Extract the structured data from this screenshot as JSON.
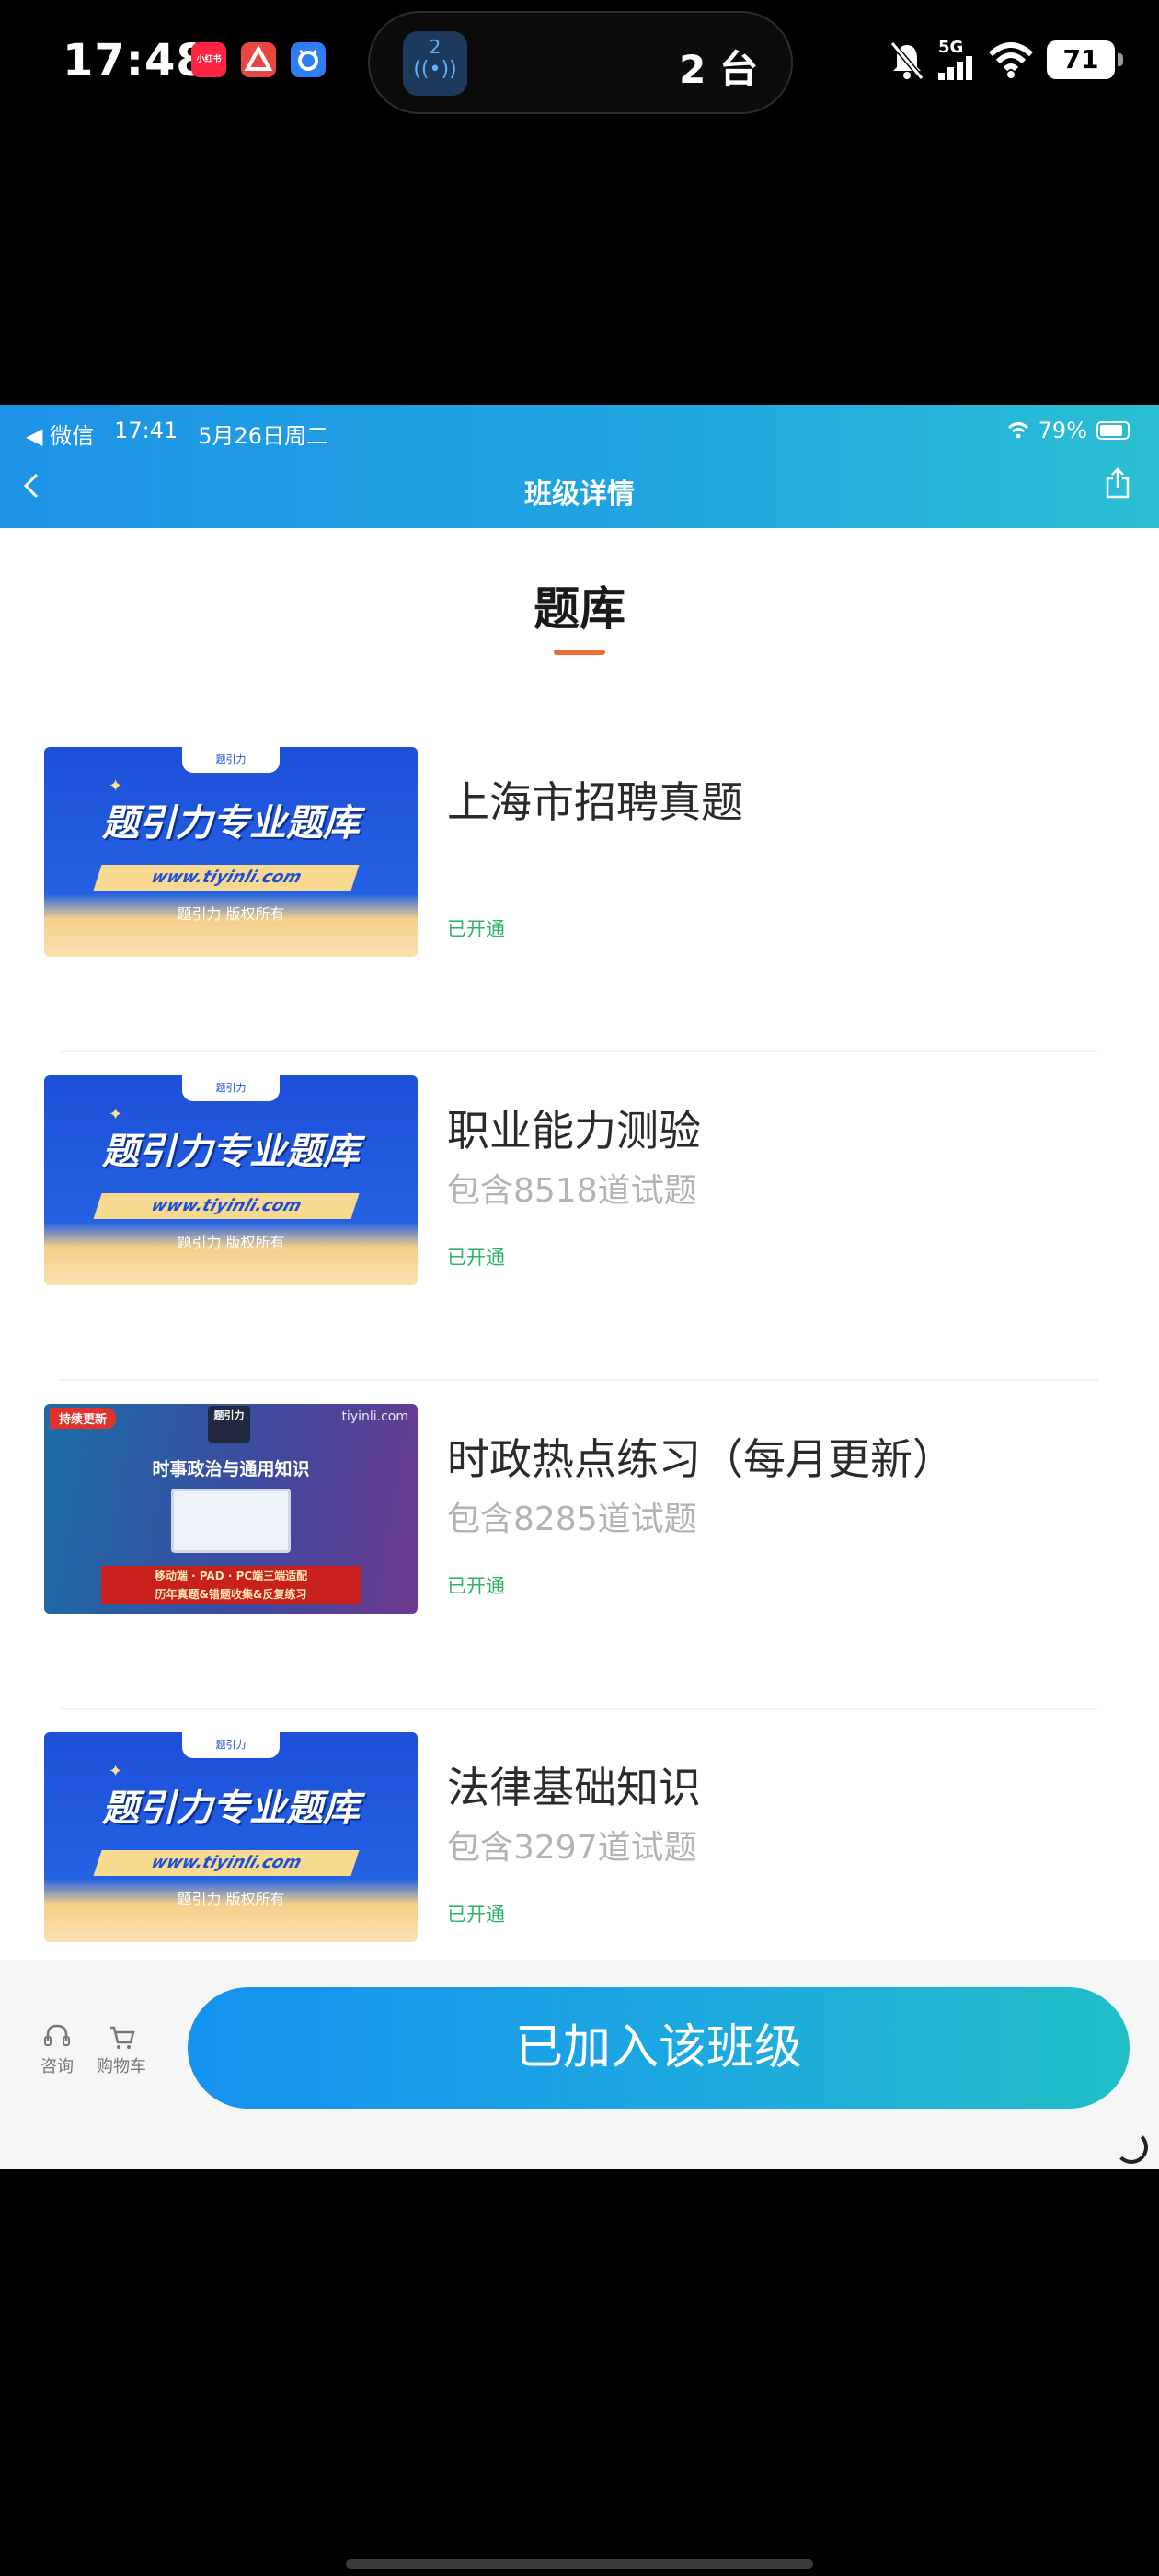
{
  "phone_status": {
    "time": "17:48",
    "app_icons": [
      {
        "name": "xiaohongshu-icon",
        "label": "小红书",
        "color": "#ff2442"
      },
      {
        "name": "alert-app-icon",
        "label": "",
        "color": "#e8463f"
      },
      {
        "name": "alarm-app-icon",
        "label": "",
        "color": "#2d7ef5"
      }
    ],
    "island": {
      "badge": "2",
      "text": "2 台"
    },
    "network": "5G",
    "battery": "71"
  },
  "app": {
    "inner_status": {
      "carrier": "◀ 微信",
      "time": "17:41",
      "date": "5月26日周二",
      "battery": "79%"
    },
    "header": {
      "back": "‹",
      "title": "班级详情"
    },
    "section": {
      "title": "题库",
      "accent": "#f26b3a"
    },
    "banks": [
      {
        "title": "上海市招聘真题",
        "count": "",
        "status": "已开通",
        "thumb": "blue"
      },
      {
        "title": "职业能力测验",
        "count": "包含8518道试题",
        "status": "已开通",
        "thumb": "blue"
      },
      {
        "title": "时政热点练习（每月更新）",
        "count": "包含8285道试题",
        "status": "已开通",
        "thumb": "purple"
      },
      {
        "title": "法律基础知识",
        "count": "包含3297道试题",
        "status": "已开通",
        "thumb": "blue"
      }
    ],
    "thumb_blue": {
      "logo": "题引力",
      "headline": "题引力专业题库",
      "url": "www.tiyinli.com",
      "copyright": "题引力 版权所有"
    },
    "thumb_purple": {
      "tag": "持续更新",
      "site": "tiyinli.com",
      "brand": "题引力",
      "subtitle": "时事政治与通用知识",
      "line1": "移动端 · PAD · PC端三端适配",
      "line2": "历年真题&错题收集&反复练习"
    },
    "bottom": {
      "consult": "咨询",
      "cart": "购物车",
      "join": "已加入该班级"
    },
    "colors": {
      "status_green": "#2fb36a",
      "primary_gradient_start": "#1591f0",
      "primary_gradient_end": "#20bfc6"
    }
  }
}
